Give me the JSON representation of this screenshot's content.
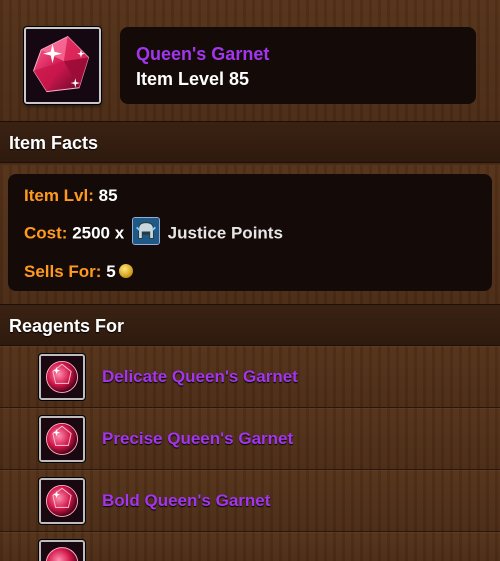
{
  "item": {
    "name": "Queen's Garnet",
    "level_text": "Item Level 85",
    "icon": "garnet-gem-icon",
    "quality_color": "#a335ee"
  },
  "sections": {
    "facts_title": "Item Facts",
    "reagents_title": "Reagents For"
  },
  "facts": {
    "item_lvl_label": "Item Lvl:",
    "item_lvl_value": "85",
    "cost_label": "Cost:",
    "cost_value": "2500 x",
    "cost_currency": "Justice Points",
    "cost_currency_icon": "justice-points-helmet-icon",
    "sells_label": "Sells For:",
    "sells_value": "5",
    "sells_icon": "copper-coin-icon"
  },
  "reagents": [
    {
      "name": "Delicate Queen's Garnet",
      "icon": "cut-garnet-icon"
    },
    {
      "name": "Precise Queen's Garnet",
      "icon": "cut-garnet-icon"
    },
    {
      "name": "Bold Queen's Garnet",
      "icon": "cut-garnet-icon"
    }
  ],
  "colors": {
    "label_orange": "#ff9a1f",
    "epic_purple": "#a335ee",
    "wood_brown": "#4a2c16"
  }
}
